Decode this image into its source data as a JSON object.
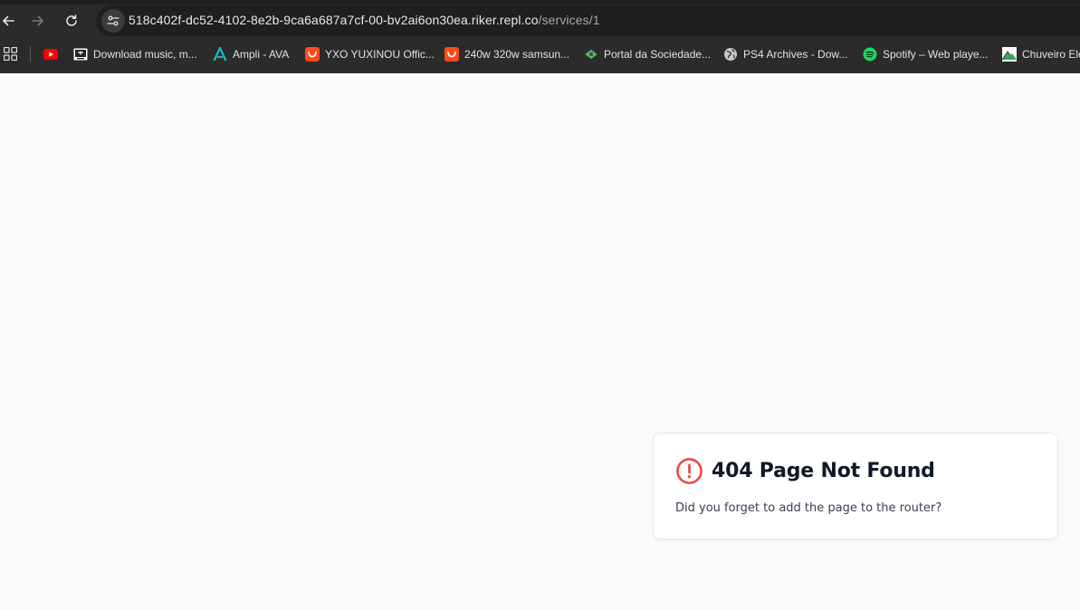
{
  "browser": {
    "url_host": "518c402f-dc52-4102-8e2b-9ca6a687a7cf-00-bv2ai6on30ea.riker.repl.co",
    "url_path": "/services/1",
    "nav": {
      "back_icon": "arrow-left-icon",
      "forward_icon": "arrow-right-icon",
      "reload_icon": "reload-icon"
    },
    "bookmarks": [
      {
        "label": "",
        "icon": "youtube-icon"
      },
      {
        "label": "Download music, m...",
        "icon": "download-music-icon"
      },
      {
        "label": "Ampli - AVA",
        "icon": "ampli-icon"
      },
      {
        "label": "YXO YUXINOU Offic...",
        "icon": "aliexpress-icon"
      },
      {
        "label": "240w 320w samsun...",
        "icon": "aliexpress-icon"
      },
      {
        "label": "Portal da Sociedade...",
        "icon": "brazil-flag-icon"
      },
      {
        "label": "PS4 Archives - Dow...",
        "icon": "globe-icon"
      },
      {
        "label": "Spotify – Web playe...",
        "icon": "spotify-icon"
      },
      {
        "label": "Chuveiro Elé",
        "icon": "mountain-icon"
      }
    ]
  },
  "page": {
    "title": "404 Page Not Found",
    "message": "Did you forget to add the page to the router?",
    "icon": "alert-circle-icon"
  },
  "colors": {
    "background": "#f8fafc",
    "alert": "#ef4444",
    "browser_chrome": "#2b2b2b"
  }
}
